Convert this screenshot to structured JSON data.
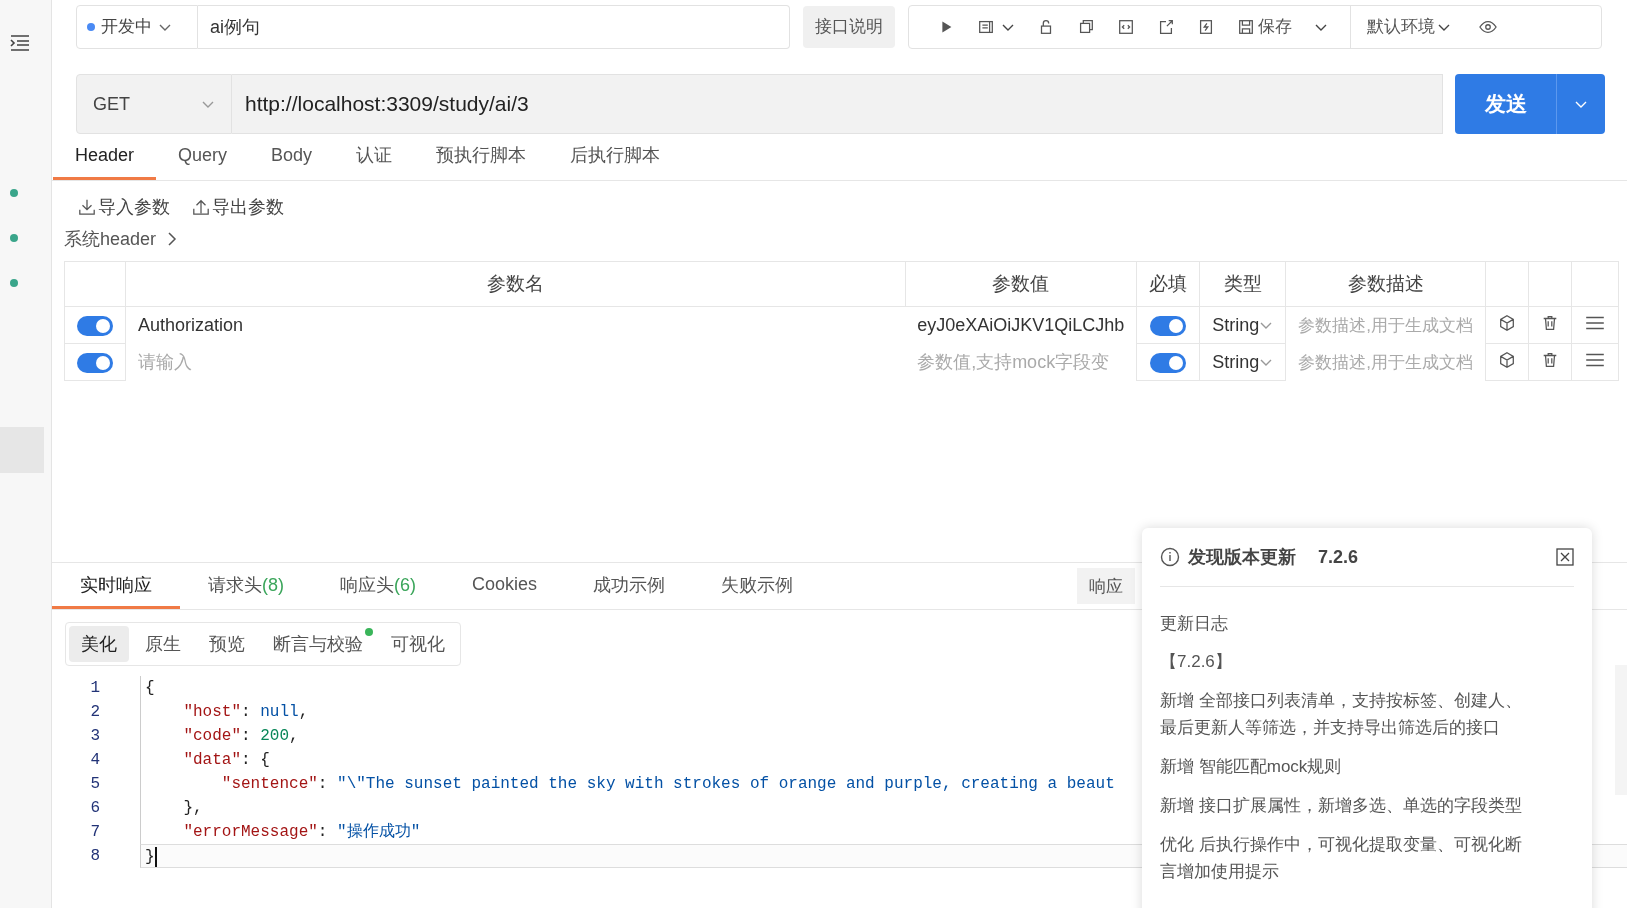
{
  "sidebar": {
    "dots": [
      {
        "color": "#3aa58a"
      },
      {
        "color": "#3aa58a"
      },
      {
        "color": "#3aa58a"
      }
    ]
  },
  "top_bar": {
    "status": {
      "label": "开发中",
      "color": "#4a8af4"
    },
    "name": {
      "value": "ai例句"
    },
    "doc_button": "接口说明",
    "save": "保存",
    "environment": "默认环境"
  },
  "request": {
    "method": "GET",
    "url": "http://localhost:3309/study/ai/3",
    "send": "发送"
  },
  "tabs": [
    {
      "label": "Header",
      "selected": true
    },
    {
      "label": "Query",
      "selected": false
    },
    {
      "label": "Body",
      "selected": false
    },
    {
      "label": "认证",
      "selected": false
    },
    {
      "label": "预执行脚本",
      "selected": false
    },
    {
      "label": "后执行脚本",
      "selected": false
    }
  ],
  "actions": [
    "导入参数",
    "导出参数"
  ],
  "system_header": "系统header",
  "table": {
    "columns": [
      "参数名",
      "参数值",
      "必填",
      "类型",
      "参数描述"
    ],
    "rows": [
      {
        "on": true,
        "name": {
          "value": "Authorization"
        },
        "value": {
          "value": "eyJ0eXAiOiJKV1QiLCJhb"
        },
        "required": true,
        "type": "String",
        "description": {
          "placeholder": "参数描述,用于生成文档"
        }
      },
      {
        "on": true,
        "name": {
          "placeholder": "请输入"
        },
        "value": {
          "placeholder": "参数值,支持mock字段变"
        },
        "required": true,
        "type": "String",
        "description": {
          "placeholder": "参数描述,用于生成文档"
        }
      }
    ]
  },
  "response": {
    "tabs": [
      {
        "label": "实时响应",
        "selected": true
      },
      {
        "label": "请求头",
        "count": "(8)",
        "selected": false
      },
      {
        "label": "响应头",
        "count": "(6)",
        "selected": false
      },
      {
        "label": "Cookies",
        "selected": false
      },
      {
        "label": "成功示例",
        "selected": false
      },
      {
        "label": "失败示例",
        "selected": false
      }
    ],
    "example_button": "响应",
    "views": [
      {
        "label": "美化",
        "selected": true,
        "dot": false
      },
      {
        "label": "原生",
        "selected": false,
        "dot": false
      },
      {
        "label": "预览",
        "selected": false,
        "dot": false
      },
      {
        "label": "断言与校验",
        "selected": false,
        "dot": true
      },
      {
        "label": "可视化",
        "selected": false,
        "dot": false
      }
    ],
    "code": [
      {
        "number": "1",
        "current": false,
        "tokens": [
          {
            "kind": "punct",
            "text": "{"
          }
        ]
      },
      {
        "number": "2",
        "current": false,
        "tokens": [
          {
            "kind": "key",
            "text": "    \"host\""
          },
          {
            "kind": "punct",
            "text": ": "
          },
          {
            "kind": "literal",
            "text": "null"
          },
          {
            "kind": "punct",
            "text": ","
          }
        ]
      },
      {
        "number": "3",
        "current": false,
        "tokens": [
          {
            "kind": "key",
            "text": "    \"code\""
          },
          {
            "kind": "punct",
            "text": ": "
          },
          {
            "kind": "number",
            "text": "200"
          },
          {
            "kind": "punct",
            "text": ","
          }
        ]
      },
      {
        "number": "4",
        "current": false,
        "tokens": [
          {
            "kind": "key",
            "text": "    \"data\""
          },
          {
            "kind": "punct",
            "text": ": {"
          }
        ]
      },
      {
        "number": "5",
        "current": false,
        "tokens": [
          {
            "kind": "key",
            "text": "        \"sentence\""
          },
          {
            "kind": "punct",
            "text": ": "
          },
          {
            "kind": "string",
            "text": "\"\\\"The sunset painted the sky with strokes of orange and purple, creating a beaut"
          }
        ]
      },
      {
        "number": "6",
        "current": false,
        "tokens": [
          {
            "kind": "punct",
            "text": "    },"
          }
        ]
      },
      {
        "number": "7",
        "current": false,
        "tokens": [
          {
            "kind": "key",
            "text": "    \"errorMessage\""
          },
          {
            "kind": "punct",
            "text": ": "
          },
          {
            "kind": "string",
            "text": "\"操作成功\""
          }
        ]
      },
      {
        "number": "8",
        "current": true,
        "tokens": [
          {
            "kind": "punct",
            "text": "}"
          }
        ]
      }
    ]
  },
  "update_popup": {
    "title": "发现版本更新",
    "version": "7.2.6",
    "heading": "更新日志",
    "release": "【7.2.6】",
    "items": [
      "新增 全部接口列表清单，支持按标签、创建人、最后更新人等筛选，并支持导出筛选后的接口",
      "新增 智能匹配mock规则",
      "新增 接口扩展属性，新增多选、单选的字段类型",
      "优化 后执行操作中，可视化提取变量、可视化断言增加使用提示"
    ]
  }
}
